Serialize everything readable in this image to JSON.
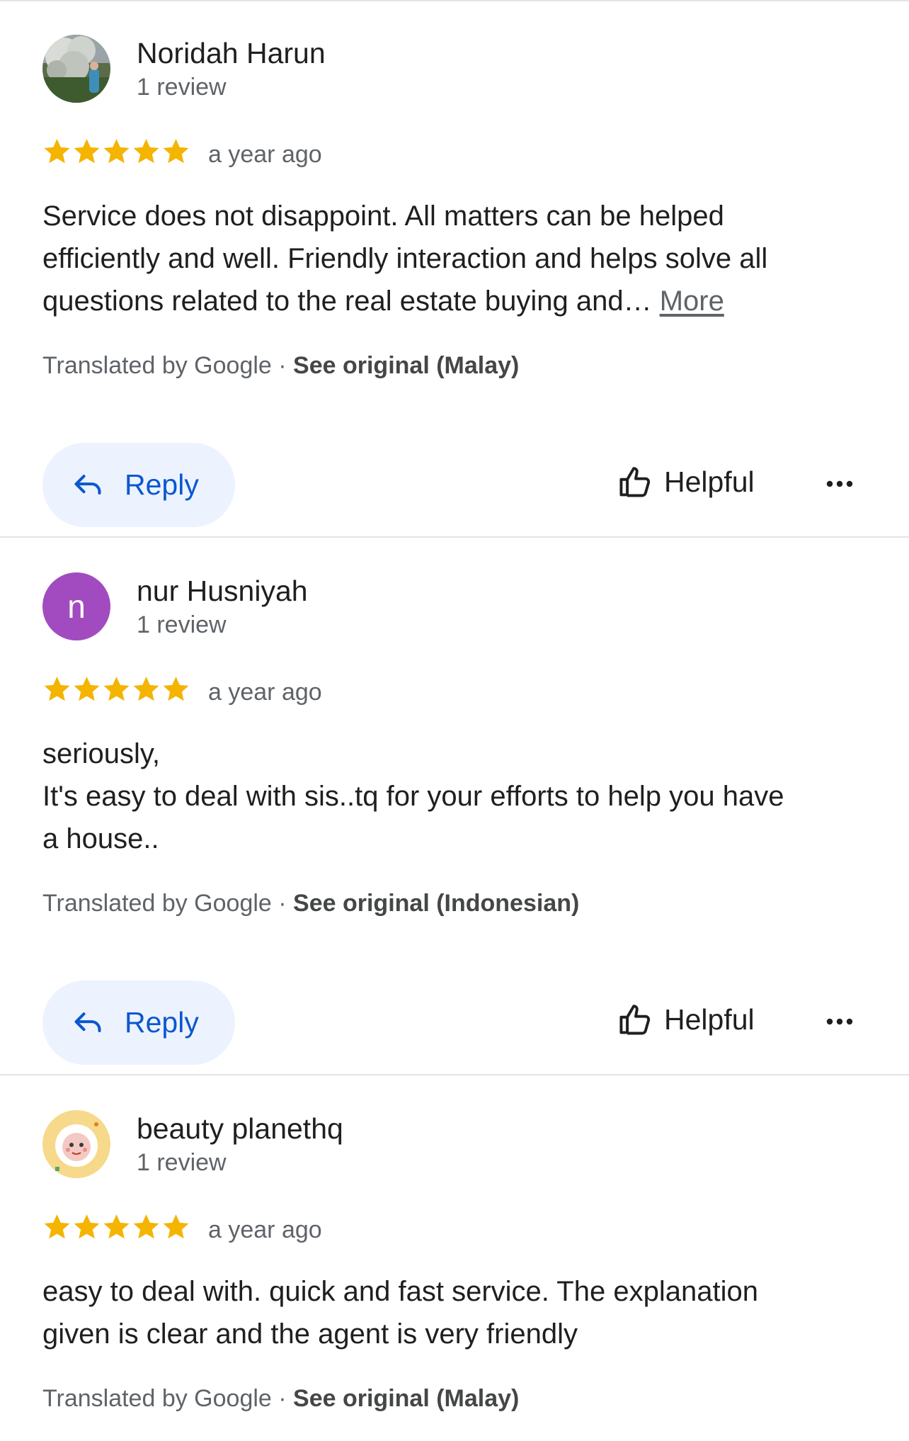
{
  "reviews": [
    {
      "author": "Noridah Harun",
      "meta": "1 review",
      "avatar_icon": "photo-avatar-tree",
      "rating": 5,
      "time": "a year ago",
      "lines": [
        "Service does not disappoint. All matters can be helped",
        "efficiently and well. Friendly interaction and helps solve all",
        "questions related to the real estate buying and… "
      ],
      "more_label": "More",
      "translated_by": "Translated by Google · ",
      "see_original": "See original (Malay)",
      "reply_label": "Reply",
      "helpful_label": "Helpful"
    },
    {
      "author": "nur Husniyah",
      "meta": "1 review",
      "avatar_letter": "n",
      "avatar_color": "#a24bc0",
      "rating": 5,
      "time": "a year ago",
      "lines": [
        "seriously,",
        "It's easy to deal with sis..tq for your efforts to help you have",
        "a house.."
      ],
      "more_label": "",
      "translated_by": "Translated by Google · ",
      "see_original": "See original (Indonesian)",
      "reply_label": "Reply",
      "helpful_label": "Helpful"
    },
    {
      "author": "beauty planethq",
      "meta": "1 review",
      "avatar_icon": "photo-avatar-cartoon",
      "rating": 5,
      "time": "a year ago",
      "lines": [
        "easy to deal with. quick and fast service. The explanation",
        "given is clear and the agent is very friendly"
      ],
      "more_label": "",
      "translated_by": "Translated by Google · ",
      "see_original": "See original (Malay)"
    }
  ],
  "colors": {
    "star": "#f4b400",
    "reply_bg": "#ecf3fe",
    "reply_text": "#0b57d0",
    "secondary_text": "#5f6368"
  }
}
